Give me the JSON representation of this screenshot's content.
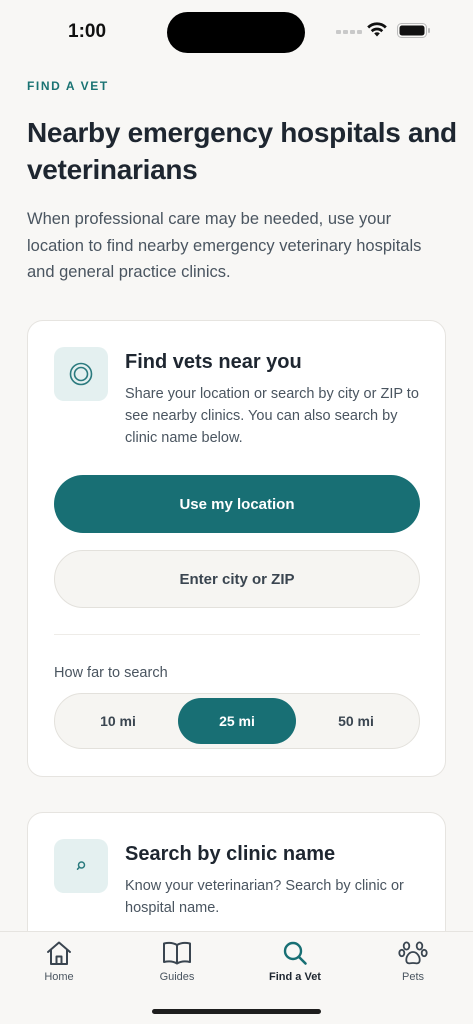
{
  "status_bar": {
    "time": "1:00"
  },
  "header": {
    "eyebrow": "FIND A VET",
    "title": "Nearby emergency hospitals and veterinarians",
    "intro": "When professional care may be needed, use your location to find nearby emergency veterinary hospitals and general practice clinics."
  },
  "find_card": {
    "icon": "location-target-icon",
    "heading": "Find vets near you",
    "description": "Share your location or search by city or ZIP to see nearby clinics. You can also search by clinic name below.",
    "use_location_label": "Use my location",
    "enter_city_label": "Enter city or ZIP",
    "distance_label": "How far to search",
    "distance_options": [
      {
        "label": "10 mi",
        "selected": false
      },
      {
        "label": "25 mi",
        "selected": true
      },
      {
        "label": "50 mi",
        "selected": false
      }
    ]
  },
  "search_card": {
    "icon": "search-icon",
    "heading": "Search by clinic name",
    "description": "Know your veterinarian? Search by clinic or hospital name."
  },
  "tab_bar": {
    "items": [
      {
        "label": "Home",
        "icon": "home-icon",
        "active": false
      },
      {
        "label": "Guides",
        "icon": "book-icon",
        "active": false
      },
      {
        "label": "Find a Vet",
        "icon": "search-icon",
        "active": true
      },
      {
        "label": "Pets",
        "icon": "paw-icon",
        "active": false
      }
    ]
  },
  "colors": {
    "accent": "#186f74",
    "eyebrow": "#1a7373",
    "background": "#f8f7f5"
  }
}
